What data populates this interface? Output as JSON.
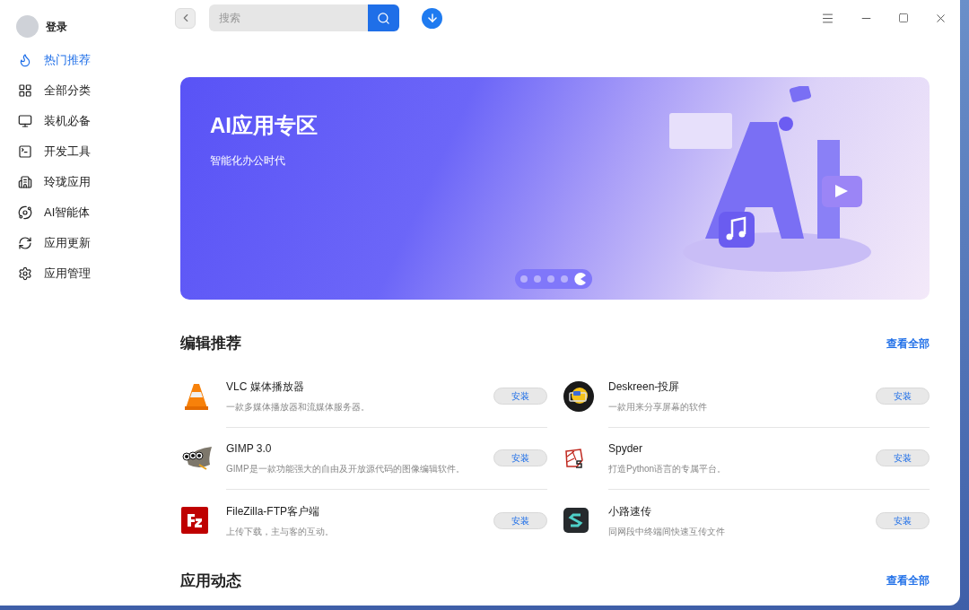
{
  "user": {
    "label": "登录"
  },
  "sidebar": {
    "items": [
      {
        "label": "热门推荐",
        "selected": true
      },
      {
        "label": "全部分类",
        "selected": false
      },
      {
        "label": "装机必备",
        "selected": false
      },
      {
        "label": "开发工具",
        "selected": false
      },
      {
        "label": "玲珑应用",
        "selected": false
      },
      {
        "label": "AI智能体",
        "selected": false
      },
      {
        "label": "应用更新",
        "selected": false
      },
      {
        "label": "应用管理",
        "selected": false
      }
    ]
  },
  "search": {
    "placeholder": "搜索"
  },
  "banner": {
    "title": "AI应用专区",
    "subtitle": "智能化办公时代",
    "pages": [
      {
        "selected": false
      },
      {
        "selected": false
      },
      {
        "selected": false
      },
      {
        "selected": false
      },
      {
        "selected": true
      }
    ]
  },
  "editor_picks": {
    "title": "编辑推荐",
    "link": "查看全部",
    "apps": [
      {
        "name": "VLC 媒体播放器",
        "description": "一款多媒体播放器和流媒体服务器。",
        "button": "安装"
      },
      {
        "name": "Deskreen-投屏",
        "description": "一款用来分享屏幕的软件",
        "button": "安装"
      },
      {
        "name": "GIMP 3.0",
        "description": "GIMP是一款功能强大的自由及开放源代码的图像编辑软件。",
        "button": "安装"
      },
      {
        "name": "Spyder",
        "description": "打造Python语言的专属平台。",
        "button": "安装"
      },
      {
        "name": "FileZilla-FTP客户端",
        "description": "上传下载，主与客的互动。",
        "button": "安装"
      },
      {
        "name": "小路速传",
        "description": "同网段中终端间快速互传文件",
        "button": "安装"
      }
    ]
  },
  "app_news": {
    "title": "应用动态",
    "link": "查看全部"
  }
}
